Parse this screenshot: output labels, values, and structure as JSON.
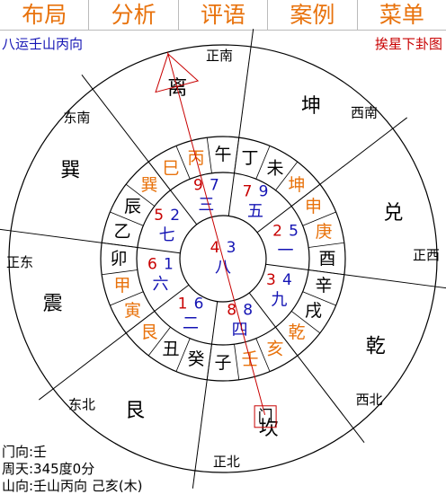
{
  "menu": [
    {
      "label": "布局",
      "name": "menu-layout"
    },
    {
      "label": "分析",
      "name": "menu-analysis"
    },
    {
      "label": "评语",
      "name": "menu-comments"
    },
    {
      "label": "案例",
      "name": "menu-cases"
    },
    {
      "label": "菜单",
      "name": "menu-main"
    }
  ],
  "subtitle": "八运壬山丙向",
  "right_link": "挨星下卦图",
  "colors": {
    "accent": "#e8720c",
    "blue": "#1414b4",
    "red": "#c80000",
    "black": "#000000"
  },
  "directions": [
    "正南",
    "西南",
    "正西",
    "西北",
    "正北",
    "东北",
    "正东",
    "东南"
  ],
  "trigrams": [
    "离",
    "坤",
    "兑",
    "乾",
    "坎",
    "艮",
    "震",
    "巽"
  ],
  "mountains": [
    {
      "t": "丙",
      "c": "accent"
    },
    {
      "t": "午",
      "c": "black"
    },
    {
      "t": "丁",
      "c": "black"
    },
    {
      "t": "未",
      "c": "black"
    },
    {
      "t": "坤",
      "c": "accent"
    },
    {
      "t": "申",
      "c": "accent"
    },
    {
      "t": "庚",
      "c": "accent"
    },
    {
      "t": "酉",
      "c": "black"
    },
    {
      "t": "辛",
      "c": "black"
    },
    {
      "t": "戌",
      "c": "black"
    },
    {
      "t": "乾",
      "c": "accent"
    },
    {
      "t": "亥",
      "c": "accent"
    },
    {
      "t": "壬",
      "c": "accent"
    },
    {
      "t": "子",
      "c": "black"
    },
    {
      "t": "癸",
      "c": "black"
    },
    {
      "t": "丑",
      "c": "black"
    },
    {
      "t": "艮",
      "c": "accent"
    },
    {
      "t": "寅",
      "c": "accent"
    },
    {
      "t": "甲",
      "c": "accent"
    },
    {
      "t": "卯",
      "c": "black"
    },
    {
      "t": "乙",
      "c": "black"
    },
    {
      "t": "辰",
      "c": "black"
    },
    {
      "t": "巽",
      "c": "accent"
    },
    {
      "t": "巳",
      "c": "accent"
    }
  ],
  "palaces": [
    {
      "pos": "S",
      "mountain": "9",
      "facing": "7",
      "base": "三"
    },
    {
      "pos": "SW",
      "mountain": "7",
      "facing": "9",
      "base": "五"
    },
    {
      "pos": "W",
      "mountain": "2",
      "facing": "5",
      "base": "一"
    },
    {
      "pos": "NW",
      "mountain": "3",
      "facing": "4",
      "base": "九"
    },
    {
      "pos": "N",
      "mountain": "8",
      "facing": "8",
      "base": "四"
    },
    {
      "pos": "NE",
      "mountain": "1",
      "facing": "6",
      "base": "二"
    },
    {
      "pos": "E",
      "mountain": "6",
      "facing": "1",
      "base": "六"
    },
    {
      "pos": "SE",
      "mountain": "5",
      "facing": "2",
      "base": "七"
    },
    {
      "pos": "C",
      "mountain": "4",
      "facing": "3",
      "base": "八"
    }
  ],
  "gate_label": "门",
  "info": {
    "gate": "门向:壬",
    "degree": "周天:345度0分",
    "mountain": "山向:壬山丙向 己亥(木)"
  }
}
